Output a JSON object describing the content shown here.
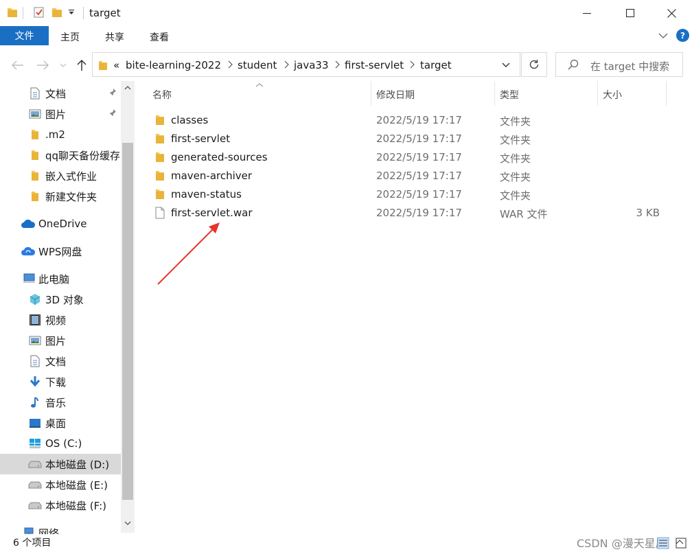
{
  "window": {
    "title": "target"
  },
  "ribbon": {
    "tabs": [
      "文件",
      "主页",
      "共享",
      "查看"
    ]
  },
  "address": {
    "overflow": "«",
    "crumbs": [
      "bite-learning-2022",
      "student",
      "java33",
      "first-servlet",
      "target"
    ]
  },
  "search": {
    "placeholder": "在 target 中搜索"
  },
  "nav": {
    "quick_access": [
      {
        "label": "文档",
        "icon": "document-icon",
        "pinned": true
      },
      {
        "label": "图片",
        "icon": "picture-icon",
        "pinned": true
      },
      {
        "label": ".m2",
        "icon": "folder-icon"
      },
      {
        "label": "qq聊天备份缓存",
        "icon": "folder-icon"
      },
      {
        "label": "嵌入式作业",
        "icon": "folder-icon"
      },
      {
        "label": "新建文件夹",
        "icon": "folder-icon"
      }
    ],
    "onedrive": "OneDrive",
    "wps": "WPS网盘",
    "this_pc": "此电脑",
    "pc_items": [
      {
        "label": "3D 对象",
        "icon": "3d-objects-icon"
      },
      {
        "label": "视频",
        "icon": "video-icon"
      },
      {
        "label": "图片",
        "icon": "picture-icon"
      },
      {
        "label": "文档",
        "icon": "document-icon"
      },
      {
        "label": "下载",
        "icon": "download-icon"
      },
      {
        "label": "音乐",
        "icon": "music-icon"
      },
      {
        "label": "桌面",
        "icon": "desktop-icon"
      },
      {
        "label": "OS (C:)",
        "icon": "windows-drive-icon"
      },
      {
        "label": "本地磁盘 (D:)",
        "icon": "drive-icon",
        "selected": true
      },
      {
        "label": "本地磁盘 (E:)",
        "icon": "drive-icon"
      },
      {
        "label": "本地磁盘 (F:)",
        "icon": "drive-icon"
      }
    ],
    "network": "网络"
  },
  "columns": {
    "name": "名称",
    "modified": "修改日期",
    "type": "类型",
    "size": "大小"
  },
  "files": [
    {
      "name": "classes",
      "modified": "2022/5/19 17:17",
      "type": "文件夹",
      "size": "",
      "icon": "folder-icon"
    },
    {
      "name": "first-servlet",
      "modified": "2022/5/19 17:17",
      "type": "文件夹",
      "size": "",
      "icon": "folder-icon"
    },
    {
      "name": "generated-sources",
      "modified": "2022/5/19 17:17",
      "type": "文件夹",
      "size": "",
      "icon": "folder-icon"
    },
    {
      "name": "maven-archiver",
      "modified": "2022/5/19 17:17",
      "type": "文件夹",
      "size": "",
      "icon": "folder-icon"
    },
    {
      "name": "maven-status",
      "modified": "2022/5/19 17:17",
      "type": "文件夹",
      "size": "",
      "icon": "folder-icon"
    },
    {
      "name": "first-servlet.war",
      "modified": "2022/5/19 17:17",
      "type": "WAR 文件",
      "size": "3 KB",
      "icon": "file-icon"
    }
  ],
  "status": {
    "count": "6 个项目"
  },
  "watermark": "CSDN @漫天星辰",
  "colors": {
    "accent": "#1a6fc4",
    "folder": "#f3c34b",
    "arrow": "#e8322c",
    "selected": "#d9d9d9"
  }
}
